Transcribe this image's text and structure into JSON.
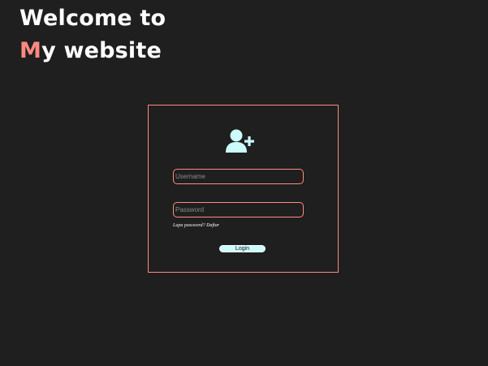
{
  "header": {
    "line1": "Welcome to",
    "line2_accent": "M",
    "line2_rest": "y website"
  },
  "login": {
    "icon": "add-user-icon",
    "username_placeholder": "Username",
    "password_placeholder": "Password",
    "forgot_text": "Lupa password?",
    "signup_link": "Daftar",
    "login_label": "Login"
  },
  "colors": {
    "background": "#1f1f1f",
    "accent": "#ff8a80",
    "icon": "#ccfbfd",
    "button": "#ccfbfd"
  }
}
